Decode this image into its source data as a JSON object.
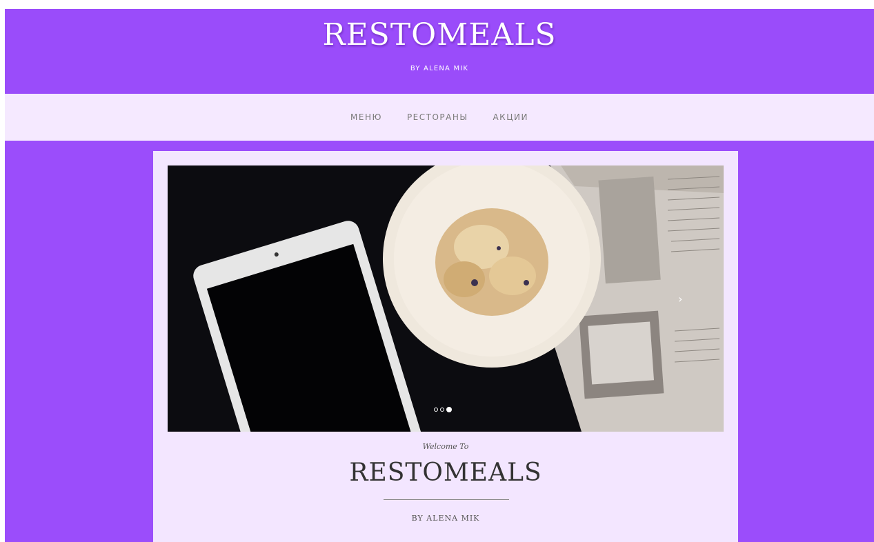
{
  "header": {
    "title": "RESTOMEALS",
    "tagline": "BY ALENA MIK"
  },
  "nav": {
    "items": [
      {
        "label": "МЕНЮ"
      },
      {
        "label": "РЕСТОРАНЫ"
      },
      {
        "label": "АКЦИИ"
      }
    ]
  },
  "slider": {
    "slide_count": 3,
    "active_slide": 3,
    "next_icon": "chevron-right-icon"
  },
  "intro": {
    "welcome": "Welcome To",
    "title": "RESTOMEALS",
    "byline": "BY ALENA MIK"
  },
  "colors": {
    "brand_purple": "#9a4cfa",
    "nav_background": "#f5e9ff",
    "card_background": "#f3e6ff"
  }
}
